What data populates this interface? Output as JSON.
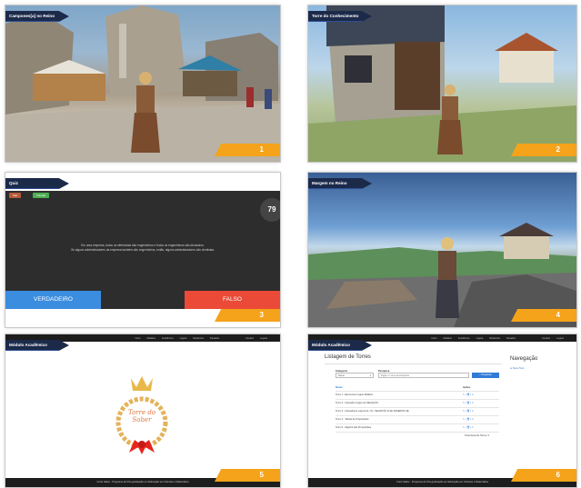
{
  "panels": [
    {
      "title": "Campones[a] no Reino",
      "number": "1"
    },
    {
      "title": "Torre do Conhecimento",
      "number": "2"
    },
    {
      "title": "Quiz",
      "number": "3"
    },
    {
      "title": "Margem no Reino",
      "number": "4"
    },
    {
      "title": "Módulo Acadêmico",
      "number": "5"
    },
    {
      "title": "Módulo Acadêmico",
      "number": "6"
    }
  ],
  "quiz": {
    "tag_left": "Sair",
    "tag_right": "Tutorial",
    "timer": "79",
    "question_line1": "Em uma empresa, todos os eletricistas são engenheiros e todos os engenheiros são dinossiros.",
    "question_line2": "Se alguns administradores da empresa também são engenheiros, então, alguns administradores são cientistas.",
    "true_label": "VERDADEIRO",
    "false_label": "FALSO"
  },
  "nav": {
    "items": [
      "Início",
      "Didática",
      "Acadêmico",
      "Lógica",
      "Relatórios",
      "Desafios"
    ],
    "right_items": [
      "Usuário",
      "Logout"
    ]
  },
  "logo": {
    "line1": "Torre do",
    "line2": "Saber"
  },
  "footer": "Corte Saber - Programa de Pós-graduação em Educação em Ciências e Matemática",
  "listing": {
    "heading": "Listagem de Torres",
    "category_label": "Categoria",
    "category_value": "Nome",
    "search_label": "Pesquisa",
    "search_placeholder": "Digite o nome da Pesquisa",
    "search_button": "Pesquisar",
    "col_name": "Nome",
    "col_actions": "Ações",
    "rows": [
      "Torre 1 - Elementos Lógica Didático",
      "Torre 2 - Operador Lógico de NEGAÇÃO",
      "Torre 3 - Operadores Lógicos E, OU, SE-ENTÃO E SE SOMENTE SE",
      "Torre 4 - Tabela de Proposições",
      "Torre 5 - Algebra das Proposições"
    ],
    "total": "Total Geral de Torres: 5",
    "side_title": "Navegação",
    "side_link": "Nova Torre"
  },
  "colors": {
    "ribbon": "#1c2a4a",
    "badge": "#f5a31a",
    "true_btn": "#3b8de0",
    "false_btn": "#ea4a37"
  }
}
